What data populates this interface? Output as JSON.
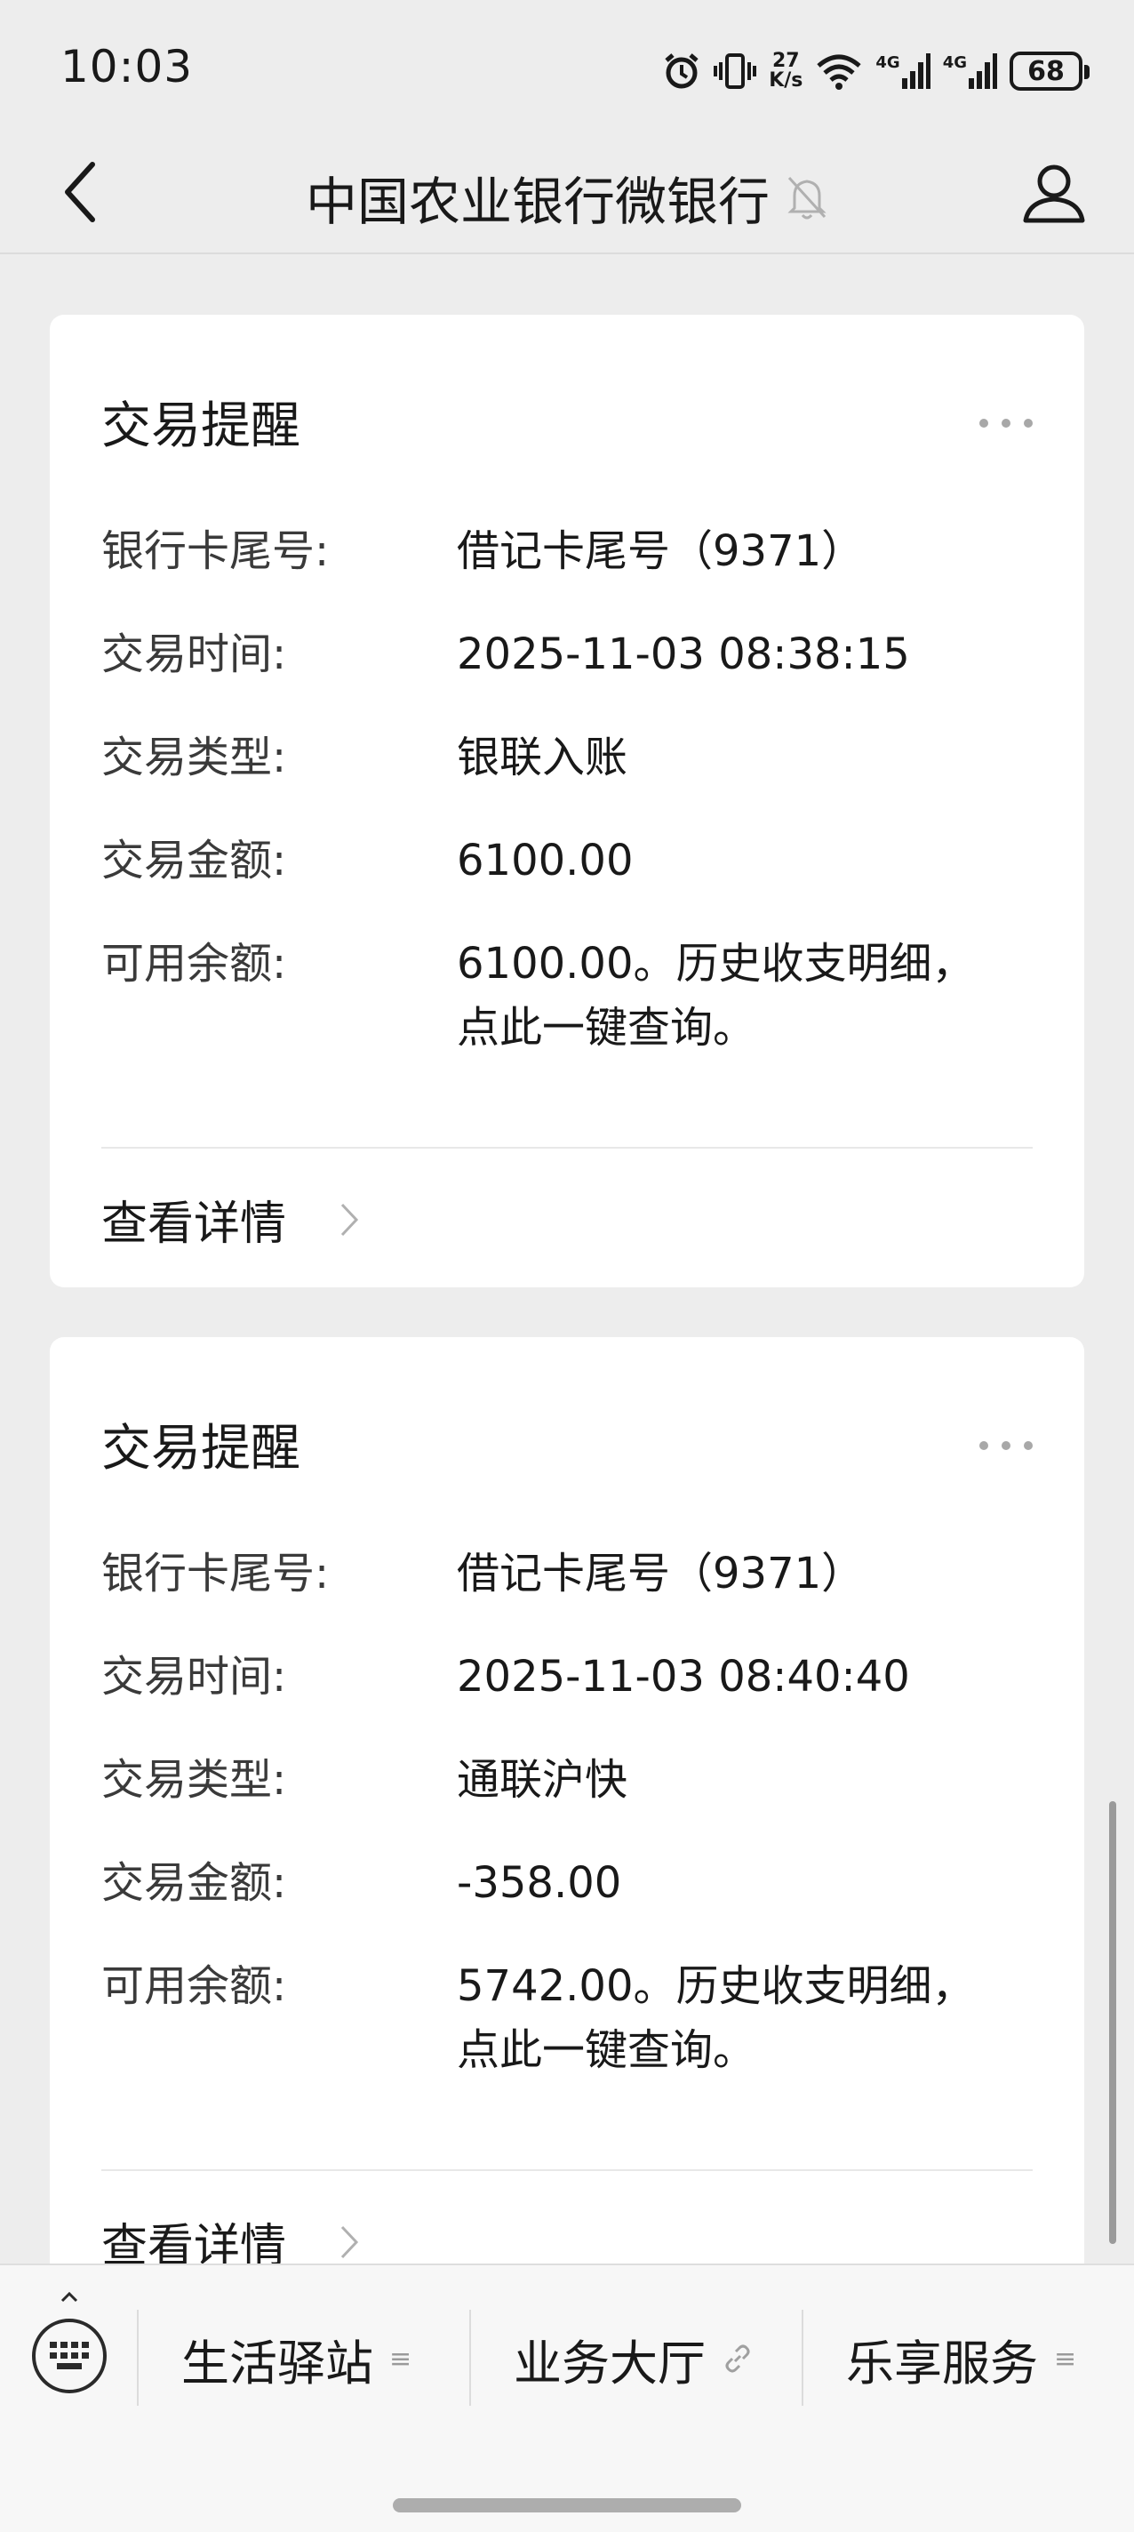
{
  "status_bar": {
    "time": "10:03",
    "net_speed_value": "27",
    "net_speed_unit": "K/s",
    "network_1": "4G",
    "network_2": "4G",
    "battery": "68"
  },
  "nav": {
    "title": "中国农业银行微银行",
    "icons": [
      "back-icon",
      "bell-off-icon",
      "profile-icon"
    ]
  },
  "cards": [
    {
      "title": "交易提醒",
      "rows": [
        {
          "label": "银行卡尾号:",
          "value": "借记卡尾号（9371）"
        },
        {
          "label": "交易时间:",
          "value": "2025-11-03 08:38:15"
        },
        {
          "label": "交易类型:",
          "value": "银联入账"
        },
        {
          "label": "交易金额:",
          "value": "6100.00"
        },
        {
          "label": "可用余额:",
          "value": "6100.00。历史收支明细，",
          "value2": "点此一键查询。"
        }
      ],
      "detail_link": "查看详情"
    },
    {
      "title": "交易提醒",
      "rows": [
        {
          "label": "银行卡尾号:",
          "value": "借记卡尾号（9371）"
        },
        {
          "label": "交易时间:",
          "value": "2025-11-03 08:40:40"
        },
        {
          "label": "交易类型:",
          "value": "通联沪快"
        },
        {
          "label": "交易金额:",
          "value": "-358.00"
        },
        {
          "label": "可用余额:",
          "value": "5742.00。历史收支明细，",
          "value2": "点此一键查询。"
        }
      ],
      "detail_link": "查看详情"
    }
  ],
  "bottom_menu": {
    "items": [
      {
        "label": "生活驿站",
        "icon": "menu-lines-icon"
      },
      {
        "label": "业务大厅",
        "icon": "link-icon"
      },
      {
        "label": "乐享服务",
        "icon": "menu-lines-icon"
      }
    ]
  }
}
